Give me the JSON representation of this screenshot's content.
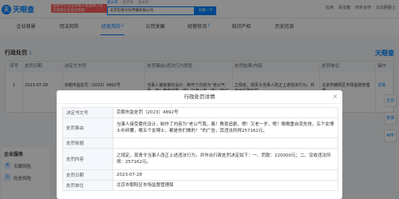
{
  "header": {
    "logo_text": "天眼查",
    "logo_mark": "天",
    "promo_text": "国家中小企业发展子基金旗下官方备案企业征信机构",
    "search_tabs": [
      "查公司",
      "查老板",
      "查关系"
    ],
    "search_value": "北京红果文化传播有限公司",
    "search_button": "天眼一下",
    "menu": [
      "应用",
      "百宝箱",
      "商务合作",
      "马龙胆爵士"
    ]
  },
  "nav": {
    "tabs": [
      {
        "label": "企业背景",
        "count": ""
      },
      {
        "label": "司法风险",
        "count": ""
      },
      {
        "label": "经营风险",
        "count": "2"
      },
      {
        "label": "公司发展",
        "count": ""
      },
      {
        "label": "经营状况",
        "count": "2"
      },
      {
        "label": "知识产权",
        "count": ""
      },
      {
        "label": "历史信息",
        "count": ""
      }
    ]
  },
  "section": {
    "title": "行政处罚",
    "count": "1",
    "watermark": "天眼查"
  },
  "table": {
    "headers": [
      "序号",
      "处罚日期",
      "决定文书号",
      "处罚事由/违法行为类型",
      "处罚结果/内容",
      "处罚单位",
      "操作"
    ],
    "row": {
      "index": "1",
      "date": "2023-07-28",
      "doc_no": "京朝市监处罚（2023）4892号",
      "reason": "当事人接受委托设计，制作了内容为“老公气我，离！教夜追剧，嗯！又老一岁，嗯！”的广告…",
      "result": "之规定，现责令当事人改正上述违法行为，并作出行政处罚…",
      "unit": "北京市朝阳区市场监督管理局",
      "op": "详情"
    }
  },
  "side_card": {
    "title": "企业服务",
    "items": [
      {
        "icon": "天",
        "label": "天眼风险"
      },
      {
        "icon": "历",
        "label": "历史风险"
      }
    ]
  },
  "float": {
    "items": [
      "企业",
      "反馈",
      "APP"
    ]
  },
  "modal": {
    "title": "行政处罚详情",
    "close": "×",
    "rows": [
      {
        "label": "决定书文号",
        "value": "京朝市监处罚（2023）4892号"
      },
      {
        "label": "处罚事由",
        "value": "当事人接受委托设计，制作了内容为“老公气我，离！教夜追剧，嗯！又老一岁，嗯！嗷嗷重自流失快，五个女博士补碎腰，嗷五个女博士，都是你们做的！”的广告，其违法所得257162元。"
      },
      {
        "label": "处罚依据",
        "value": ""
      },
      {
        "label": "处罚内容",
        "value": "之规定，现责令当事人改正上述违法行为，并作出行政处罚决定如下：一、罚款：220000元；二、没收违法所得：257162元。"
      },
      {
        "label": "处罚日期",
        "value": "2023-07-28"
      },
      {
        "label": "处罚单位",
        "value": "北京市朝阳区市场监督管理局"
      }
    ]
  }
}
